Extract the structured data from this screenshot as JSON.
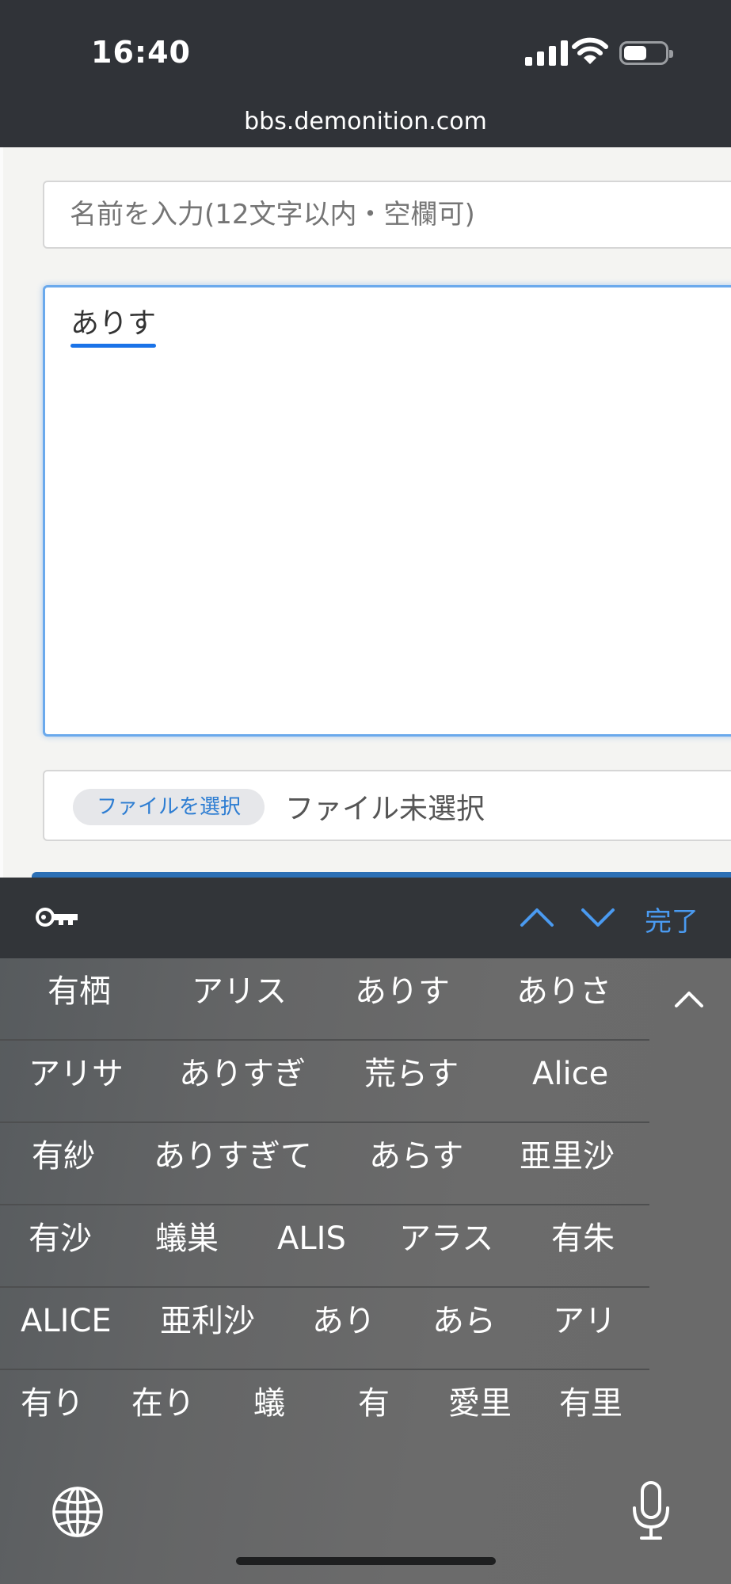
{
  "status_bar": {
    "time": "16:40"
  },
  "browser": {
    "url": "bbs.demonition.com"
  },
  "form": {
    "name_placeholder": "名前を入力(12文字以内・空欄可)",
    "message_text": "ありす",
    "file_button": "ファイルを選択",
    "file_status": "ファイル未選択"
  },
  "accessory_bar": {
    "done_label": "完了"
  },
  "keyboard": {
    "candidate_rows": [
      [
        "有栖",
        "アリス",
        "ありす",
        "ありさ"
      ],
      [
        "アリサ",
        "ありすぎ",
        "荒らす",
        "Alice"
      ],
      [
        "有紗",
        "ありすぎて",
        "あらす",
        "亜里沙"
      ],
      [
        "有沙",
        "蟻巣",
        "ALIS",
        "アラス",
        "有朱"
      ],
      [
        "ALICE",
        "亜利沙",
        "あり",
        "あら",
        "アリ"
      ],
      [
        "有り",
        "在り",
        "蟻",
        "有",
        "愛里",
        "有里"
      ]
    ]
  }
}
